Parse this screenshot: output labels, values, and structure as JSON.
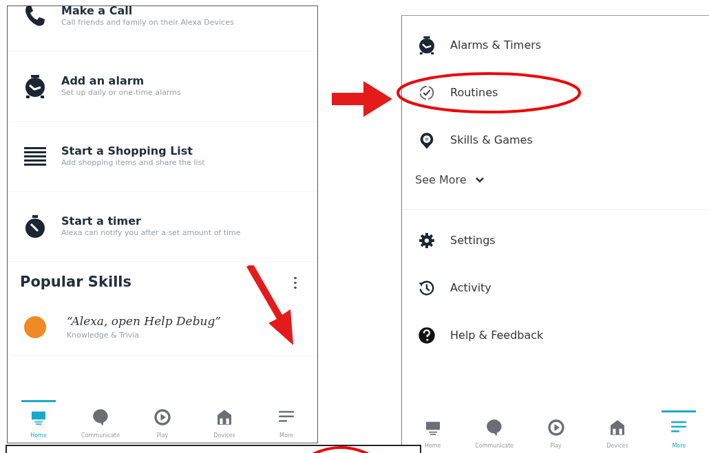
{
  "left_screen": {
    "actions": [
      {
        "kind": "phone",
        "title": "Make a Call",
        "subtitle": "Call friends and family on their Alexa Devices"
      },
      {
        "kind": "alarm",
        "title": "Add an alarm",
        "subtitle": "Set up daily or one-time alarms"
      },
      {
        "kind": "list",
        "title": "Start a Shopping List",
        "subtitle": "Add shopping items and share the list"
      },
      {
        "kind": "timer",
        "title": "Start a timer",
        "subtitle": "Alexa can notify you after a set amount of time"
      }
    ],
    "section_title": "Popular Skills",
    "skills": [
      {
        "color": "#f08a24",
        "title": "“Alexa, open Help Debug”",
        "category": "Knowledge & Trivia"
      }
    ],
    "nav": [
      {
        "kind": "home",
        "label": "Home",
        "selected": true
      },
      {
        "kind": "communicate",
        "label": "Communicate",
        "selected": false
      },
      {
        "kind": "play",
        "label": "Play",
        "selected": false
      },
      {
        "kind": "devices",
        "label": "Devices",
        "selected": false
      },
      {
        "kind": "more",
        "label": "More",
        "selected": false
      }
    ]
  },
  "right_screen": {
    "menu": [
      {
        "kind": "alarm",
        "label": "Alarms & Timers",
        "circled": false
      },
      {
        "kind": "routine",
        "label": "Routines",
        "circled": true
      },
      {
        "kind": "pin",
        "label": "Skills & Games",
        "circled": false
      }
    ],
    "see_more": "See More",
    "settings_menu": [
      {
        "kind": "gear",
        "label": "Settings"
      },
      {
        "kind": "history",
        "label": "Activity"
      },
      {
        "kind": "help",
        "label": "Help & Feedback"
      }
    ],
    "nav": [
      {
        "kind": "home",
        "label": "Home",
        "selected": false
      },
      {
        "kind": "communicate",
        "label": "Communicate",
        "selected": false
      },
      {
        "kind": "play",
        "label": "Play",
        "selected": false
      },
      {
        "kind": "devices",
        "label": "Devices",
        "selected": false
      },
      {
        "kind": "more",
        "label": "More",
        "selected": true
      }
    ]
  }
}
